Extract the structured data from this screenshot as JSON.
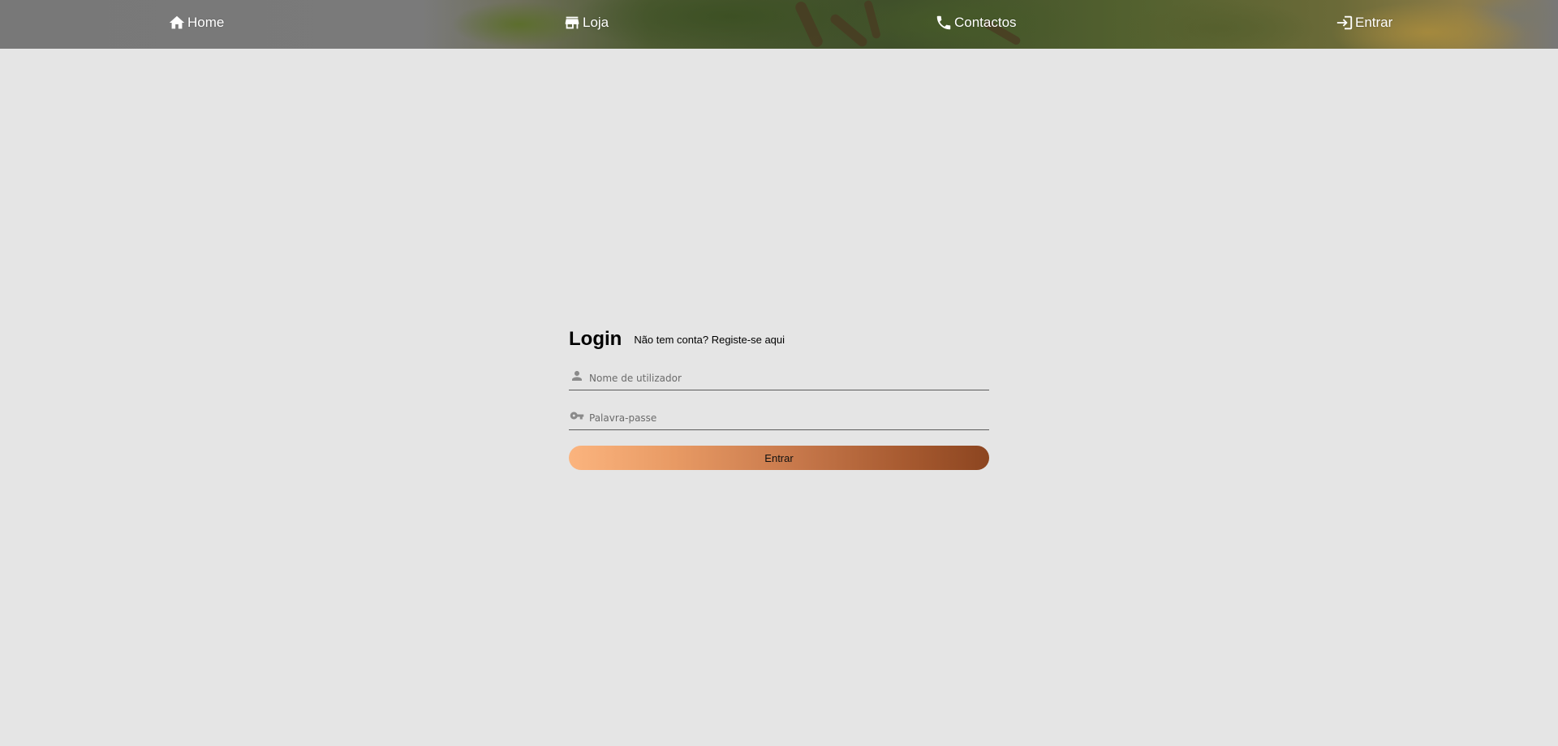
{
  "nav": {
    "items": [
      {
        "label": "Home",
        "icon": "home-icon"
      },
      {
        "label": "Loja",
        "icon": "store-icon"
      },
      {
        "label": "Contactos",
        "icon": "phone-icon"
      },
      {
        "label": "Entrar",
        "icon": "login-icon"
      }
    ]
  },
  "login": {
    "title": "Login",
    "register_link": "Não tem conta? Registe-se aqui",
    "username": {
      "placeholder": "Nome de utilizador",
      "value": "",
      "icon": "person-icon"
    },
    "password": {
      "placeholder": "Palavra-passe",
      "value": "",
      "icon": "key-icon"
    },
    "submit_label": "Entrar"
  },
  "colors": {
    "page_background": "#e5e5e5",
    "button_gradient_start": "#fbb47e",
    "button_gradient_end": "#8c4520",
    "nav_text": "#ffffff"
  }
}
